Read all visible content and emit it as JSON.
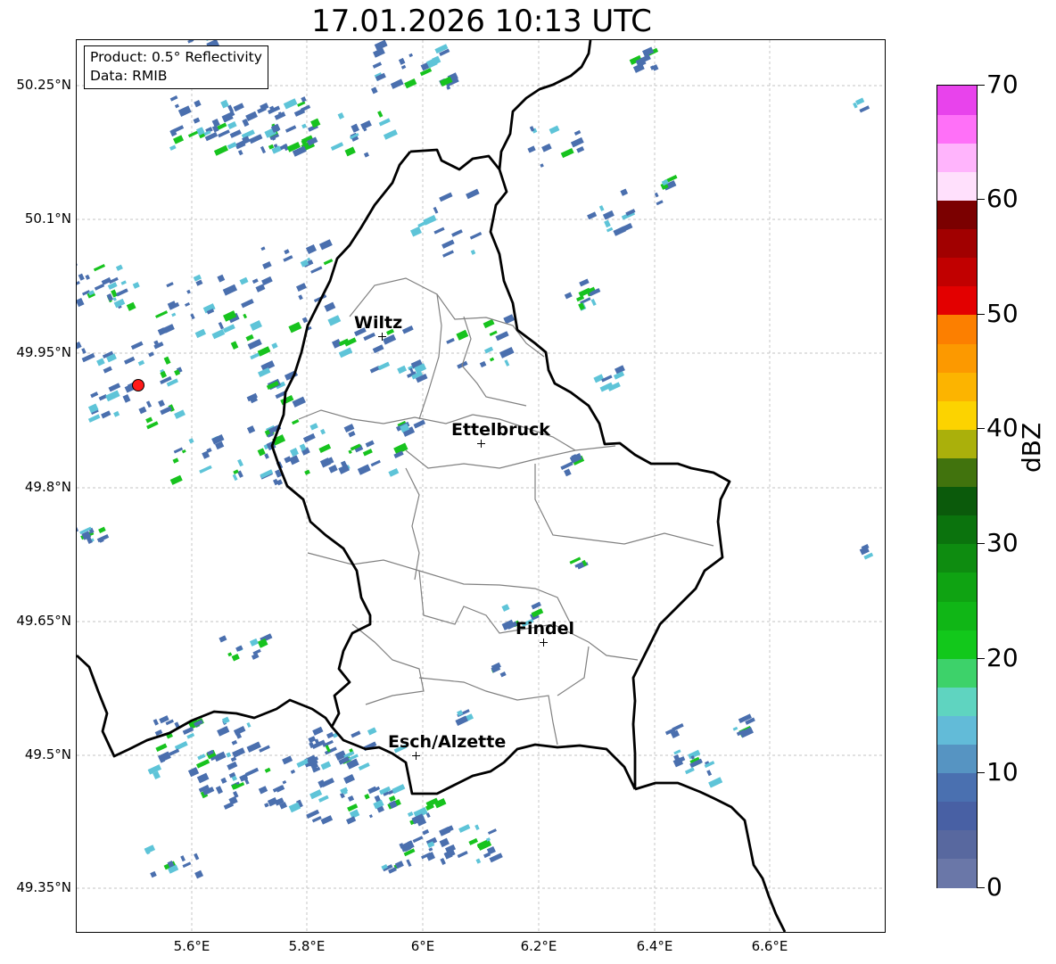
{
  "title": "17.01.2026 10:13 UTC",
  "info_box": {
    "product": "Product: 0.5° Reflectivity",
    "data": "Data: RMIB"
  },
  "axes": {
    "lat_ticks": [
      "50.25°N",
      "50.1°N",
      "49.95°N",
      "49.8°N",
      "49.65°N",
      "49.5°N",
      "49.35°N"
    ],
    "lon_ticks": [
      "5.6°E",
      "5.8°E",
      "6°E",
      "6.2°E",
      "6.4°E",
      "6.6°E"
    ],
    "grid": true
  },
  "cities": [
    {
      "name": "Wiltz",
      "lat": 49.966,
      "lon": 5.932
    },
    {
      "name": "Ettelbruck",
      "lat": 49.847,
      "lon": 6.104
    },
    {
      "name": "Findel",
      "lat": 49.627,
      "lon": 6.211
    },
    {
      "name": "Esch/Alzette",
      "lat": 49.496,
      "lon": 5.987
    }
  ],
  "radar_site": {
    "lat": 49.914,
    "lon": 5.505,
    "color": "#ff1a1a"
  },
  "colorbar": {
    "unit": "dBZ",
    "min": 0,
    "max": 70,
    "tick_labels": [
      "0",
      "10",
      "20",
      "30",
      "40",
      "50",
      "60",
      "70"
    ],
    "colors": [
      "#6a77a8",
      "#58689f",
      "#4860a4",
      "#4a70b0",
      "#5694c2",
      "#62bbd8",
      "#5fd4c0",
      "#3dd26a",
      "#12c81b",
      "#10b616",
      "#0fa312",
      "#0e8c10",
      "#0b730d",
      "#0b5a0b",
      "#41730d",
      "#aab00b",
      "#fcd300",
      "#fcb400",
      "#fc9900",
      "#fc7f00",
      "#e30000",
      "#c10000",
      "#a10000",
      "#7b0000",
      "#ffe0fc",
      "#ffb4fc",
      "#ff70f8",
      "#e843ec"
    ]
  },
  "colors": {
    "country_border": "#000000",
    "canton_border": "#808080",
    "gridline": "#b0b0b0",
    "radar_low": "#4a6fae",
    "radar_mid": "#5ec4d8",
    "radar_high": "#17c31e"
  }
}
